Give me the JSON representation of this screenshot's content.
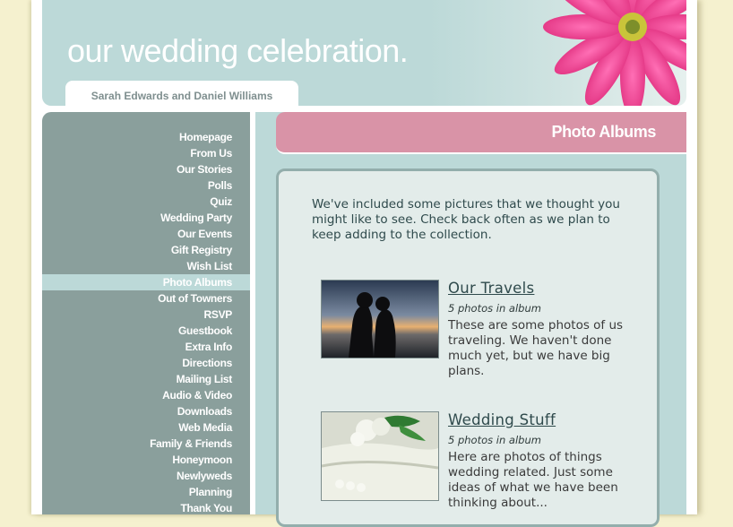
{
  "header": {
    "site_title": "our wedding celebration.",
    "couple_names": "Sarah Edwards and Daniel Williams"
  },
  "sidebar": {
    "items": [
      {
        "label": "Homepage"
      },
      {
        "label": "From Us"
      },
      {
        "label": "Our Stories"
      },
      {
        "label": "Polls"
      },
      {
        "label": "Quiz"
      },
      {
        "label": "Wedding Party"
      },
      {
        "label": "Our Events"
      },
      {
        "label": "Gift Registry"
      },
      {
        "label": "Wish List"
      },
      {
        "label": "Photo Albums",
        "active": true
      },
      {
        "label": "Out of Towners"
      },
      {
        "label": "RSVP"
      },
      {
        "label": "Guestbook"
      },
      {
        "label": "Extra Info"
      },
      {
        "label": "Directions"
      },
      {
        "label": "Mailing List"
      },
      {
        "label": "Audio & Video"
      },
      {
        "label": "Downloads"
      },
      {
        "label": "Web Media"
      },
      {
        "label": "Family & Friends"
      },
      {
        "label": "Honeymoon"
      },
      {
        "label": "Newlyweds"
      },
      {
        "label": "Planning"
      },
      {
        "label": "Thank You"
      }
    ]
  },
  "main": {
    "section_title": "Photo Albums",
    "intro": "We've included some pictures that we thought you might like to see.  Check back often as we plan to keep adding to the collection.",
    "albums": [
      {
        "title": "Our Travels",
        "count": "5 photos in album",
        "description": "These are some photos of us traveling. We haven't done much yet, but we have big plans."
      },
      {
        "title": "Wedding Stuff",
        "count": "5 photos in album",
        "description": "Here are photos of things wedding related. Just some ideas of what we have been thinking about..."
      }
    ]
  },
  "colors": {
    "background": "#f5f1cf",
    "header_teal": "#bcd9d8",
    "sidebar": "#8a9f9c",
    "section_pink": "#d993a7",
    "content_box": "#e3ecea",
    "text_dark": "#2f4a4c"
  }
}
